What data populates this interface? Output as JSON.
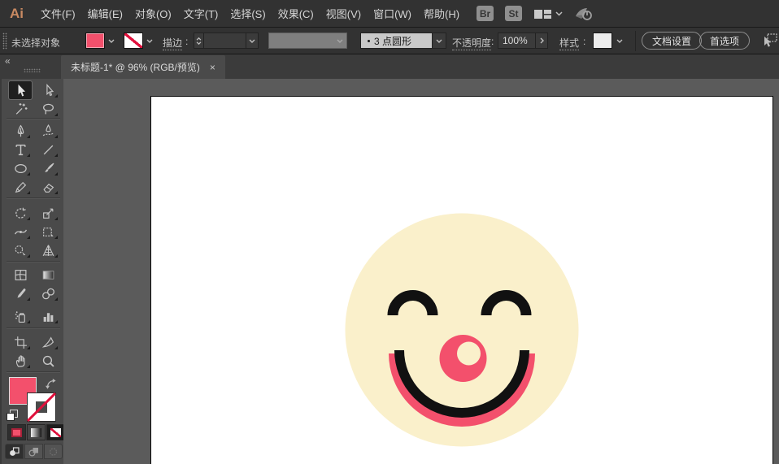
{
  "menubar": {
    "logo": "Ai",
    "items": [
      "文件(F)",
      "编辑(E)",
      "对象(O)",
      "文字(T)",
      "选择(S)",
      "效果(C)",
      "视图(V)",
      "窗口(W)",
      "帮助(H)"
    ],
    "bridge_badge": "Br",
    "stock_badge": "St"
  },
  "optionsbar": {
    "no_selection_label": "未选择对象",
    "stroke_label": "描边",
    "stroke_weight_value": "",
    "brush_name": "3 点圆形",
    "opacity_label": "不透明度",
    "opacity_value": "100%",
    "style_label": "样式",
    "document_setup_button": "文档设置",
    "preferences_button": "首选项"
  },
  "document_tab": {
    "title": "未标题-1* @ 96% (RGB/预览)",
    "close_icon": "×"
  },
  "dock": {
    "collapse_icon": "«"
  },
  "toolbar": {
    "selected_tool": "selection",
    "tools": [
      "selection",
      "direct-selection",
      "magic-wand",
      "lasso",
      "pen",
      "curvature",
      "type",
      "line-segment",
      "ellipse",
      "paintbrush",
      "shaper-pencil",
      "eraser",
      "rotate",
      "scale",
      "width",
      "free-transform",
      "shape-builder",
      "perspective-grid",
      "mesh",
      "gradient",
      "eyedropper",
      "blend",
      "symbol-sprayer",
      "column-graph",
      "artboard",
      "slice",
      "hand",
      "zoom"
    ],
    "fill_color": "#F3506C",
    "stroke": "none"
  },
  "artwork": {
    "face_fill": "#FAF0CB",
    "line_black": "#111111",
    "accent_pink": "#F3506C"
  }
}
